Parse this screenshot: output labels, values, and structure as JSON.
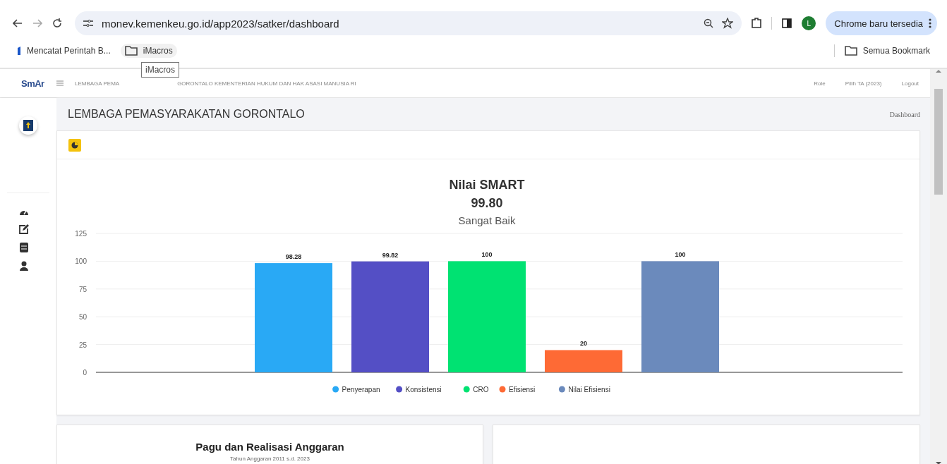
{
  "browser": {
    "url": "monev.kemenkeu.go.id/app2023/satker/dashboard",
    "profile_initial": "L",
    "update_chip": "Chrome baru tersedia",
    "bookmarks": [
      {
        "label": "Mencatat Perintah B...",
        "kind": "site"
      },
      {
        "label": "iMacros",
        "kind": "folder"
      }
    ],
    "all_bookmarks": "Semua Bookmark",
    "tooltip": "iMacros"
  },
  "app": {
    "logo": "SmAr",
    "header_text_parts": [
      "LEMBAGA PEMA",
      "GORONTALO KEMENTERIAN HUKUM DAN HAK ASASI MANUSIA RI"
    ],
    "nav": [
      "Role",
      "Pilih TA (2023)",
      "Logout"
    ],
    "page_title": "LEMBAGA PEMASYARAKATAN GORONTALO",
    "breadcrumb": "Dashboard"
  },
  "smart_card": {
    "score": "99.80",
    "rating": "Sangat Baik",
    "chart_data": {
      "type": "bar",
      "title": "Nilai SMART",
      "ylim": [
        0,
        125
      ],
      "yticks": [
        0,
        25,
        50,
        75,
        100,
        125
      ],
      "data_labels": true,
      "grid": true,
      "legend": true,
      "series": [
        {
          "name": "Penyerapan",
          "color": "#29a9f5",
          "values": [
            98.28
          ]
        },
        {
          "name": "Konsistensi",
          "color": "#544fc5",
          "values": [
            99.82
          ]
        },
        {
          "name": "CRO",
          "color": "#00e272",
          "values": [
            100
          ]
        },
        {
          "name": "Efisiensi",
          "color": "#fe6a35",
          "values": [
            20
          ]
        },
        {
          "name": "Nilai Efisiensi",
          "color": "#6b8abc",
          "values": [
            100
          ]
        }
      ]
    }
  },
  "budget_card": {
    "title": "Pagu dan Realisasi Anggaran",
    "subtitle": "Tahun Anggaran 2011 s.d. 2023"
  }
}
